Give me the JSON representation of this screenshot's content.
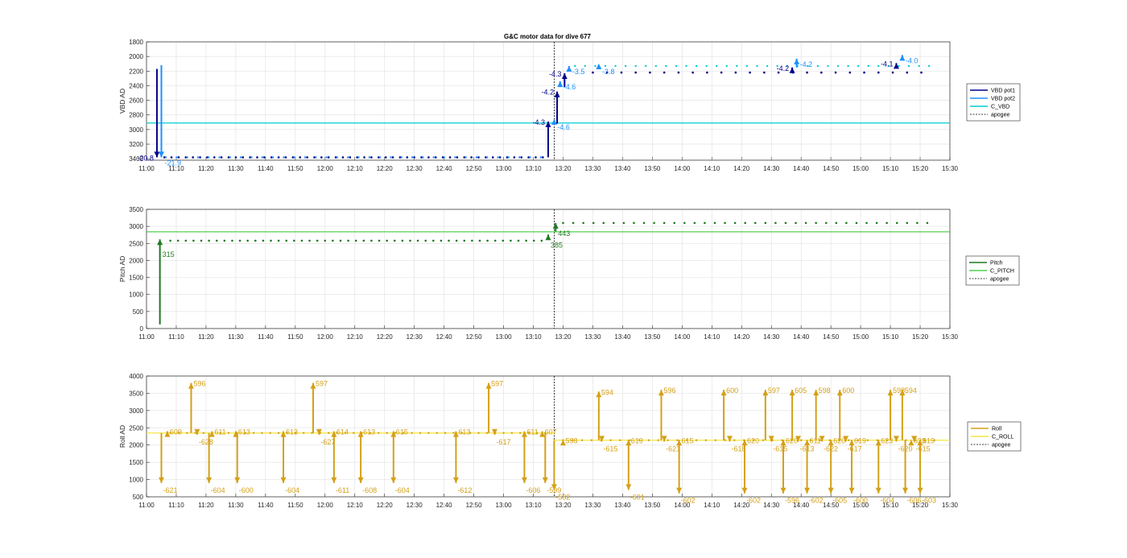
{
  "figure_title": "G&C motor data for dive 677",
  "chart_data": [
    {
      "id": "vbd",
      "type": "scatter",
      "ylabel": "VBD AD",
      "x_ticks": [
        "11:00",
        "11:10",
        "11:20",
        "11:30",
        "11:40",
        "11:50",
        "12:00",
        "12:10",
        "12:20",
        "12:30",
        "12:40",
        "12:50",
        "13:00",
        "13:10",
        "13:20",
        "13:30",
        "13:40",
        "13:50",
        "14:00",
        "14:10",
        "14:20",
        "14:30",
        "14:40",
        "14:50",
        "15:00",
        "15:10",
        "15:20",
        "15:30"
      ],
      "xlim": [
        0,
        270
      ],
      "ylim": [
        3420,
        1800
      ],
      "y_reversed": true,
      "y_ticks": [
        "1800",
        "2000",
        "2200",
        "2400",
        "2600",
        "2800",
        "3000",
        "3200",
        "3400"
      ],
      "grid": true,
      "apogee_x": 137,
      "legend": [
        "VBD pot1",
        "VBD pot2",
        "C_VBD",
        "apogee"
      ],
      "colors": {
        "pot1": "#00008b",
        "pot2": "#1e90ff",
        "cvbd": "#00ced1",
        "apogee": "#000000"
      },
      "c_vbd": 2910,
      "pot1_moves": [
        [
          3.5,
          2170,
          3380,
          "-20.8"
        ],
        [
          135,
          3380,
          2890,
          "-4.3"
        ],
        [
          138,
          2920,
          2480,
          "-4.2"
        ],
        [
          140.5,
          2420,
          2230,
          "-4.3"
        ],
        [
          217,
          2220,
          2150,
          "-4.2"
        ],
        [
          252,
          2150,
          2090,
          "-4.1"
        ]
      ],
      "pot2_moves": [
        [
          5,
          2120,
          3380,
          "-21.9"
        ],
        [
          137,
          2890,
          2890,
          "-4.6"
        ],
        [
          139,
          2420,
          2340,
          "-4.6"
        ],
        [
          142,
          2200,
          2130,
          "-3.5"
        ],
        [
          152,
          2130,
          2130,
          "-3.8"
        ],
        [
          218.5,
          2150,
          2030,
          "-4.2"
        ],
        [
          254,
          2020,
          1980,
          "-4.0"
        ]
      ],
      "pot1_points": {
        "start": 6,
        "end": 134,
        "step": 2.4,
        "y": 3380,
        "late_start": 150,
        "late_end": 262,
        "late_step": 4.8,
        "late_y": 2220
      },
      "pot2_points": {
        "start": 6.5,
        "end": 134,
        "step": 3.6,
        "y": 3380,
        "late_start": 144,
        "late_end": 265,
        "late_step": 3.4,
        "late_y": 2130
      }
    },
    {
      "id": "pitch",
      "type": "scatter",
      "ylabel": "Pitch AD",
      "x_ticks": [
        "11:00",
        "11:10",
        "11:20",
        "11:30",
        "11:40",
        "11:50",
        "12:00",
        "12:10",
        "12:20",
        "12:30",
        "12:40",
        "12:50",
        "13:00",
        "13:10",
        "13:20",
        "13:30",
        "13:40",
        "13:50",
        "14:00",
        "14:10",
        "14:20",
        "14:30",
        "14:40",
        "14:50",
        "15:00",
        "15:10",
        "15:20",
        "15:30"
      ],
      "xlim": [
        0,
        270
      ],
      "ylim": [
        0,
        3500
      ],
      "y_ticks": [
        "0",
        "500",
        "1000",
        "1500",
        "2000",
        "2500",
        "3000",
        "3500"
      ],
      "grid": true,
      "apogee_x": 137,
      "legend": [
        "Pitch",
        "C_PITCH",
        "apogee"
      ],
      "colors": {
        "pitch": "#1f7a1f",
        "cpitch": "#50d050",
        "apogee": "#000000"
      },
      "c_pitch": 2840,
      "moves": [
        [
          4.5,
          120,
          2620,
          "315"
        ],
        [
          135,
          2600,
          2760,
          "385"
        ],
        [
          137.5,
          2850,
          3100,
          "443"
        ]
      ],
      "points": {
        "start": 8,
        "end": 134,
        "step": 2.6,
        "y": 2580,
        "late_start": 140,
        "late_end": 265,
        "late_step": 3.4,
        "late_y": 3100
      }
    },
    {
      "id": "roll",
      "type": "scatter",
      "ylabel": "Roll AD",
      "x_ticks": [
        "11:00",
        "11:10",
        "11:20",
        "11:30",
        "11:40",
        "11:50",
        "12:00",
        "12:10",
        "12:20",
        "12:30",
        "12:40",
        "12:50",
        "13:00",
        "13:10",
        "13:20",
        "13:30",
        "13:40",
        "13:50",
        "14:00",
        "14:10",
        "14:20",
        "14:30",
        "14:40",
        "14:50",
        "15:00",
        "15:10",
        "15:20",
        "15:30"
      ],
      "xlim": [
        0,
        270
      ],
      "ylim": [
        500,
        4000
      ],
      "y_ticks": [
        "500",
        "1000",
        "1500",
        "2000",
        "2500",
        "3000",
        "3500",
        "4000"
      ],
      "grid": true,
      "apogee_x": 137,
      "legend": [
        "Roll",
        "C_ROLL",
        "apogee"
      ],
      "colors": {
        "roll": "#d4a017",
        "croll": "#f5e642",
        "apogee": "#000000"
      },
      "c_roll_early": 2350,
      "c_roll_late": 2140,
      "early_y": 2350,
      "late_y": 2140,
      "spikes": [
        [
          5,
          "-621",
          900
        ],
        [
          7,
          "609",
          2400
        ],
        [
          15,
          "596",
          3800
        ],
        [
          17,
          "-628",
          2300
        ],
        [
          22,
          "611",
          2400
        ],
        [
          21,
          "-604",
          900
        ],
        [
          30,
          "613",
          2400
        ],
        [
          30.5,
          "-600",
          900
        ],
        [
          46,
          "613",
          2400
        ],
        [
          46,
          "-604",
          900
        ],
        [
          56,
          "597",
          3800
        ],
        [
          58,
          "-627",
          2300
        ],
        [
          63,
          "614",
          2400
        ],
        [
          63,
          "-611",
          900
        ],
        [
          72,
          "613",
          2400
        ],
        [
          72,
          "-608",
          900
        ],
        [
          83,
          "615",
          2400
        ],
        [
          83,
          "-604",
          900
        ],
        [
          104,
          "613",
          2400
        ],
        [
          104,
          "-612",
          900
        ],
        [
          115,
          "597",
          3800
        ],
        [
          117,
          "-617",
          2300
        ],
        [
          127,
          "611",
          2400
        ],
        [
          127,
          "-606",
          900
        ],
        [
          133,
          "607",
          2400
        ],
        [
          134,
          "-599",
          900
        ],
        [
          137,
          "-582",
          700
        ],
        [
          140,
          "598",
          2150
        ],
        [
          152,
          "594",
          3550
        ],
        [
          153,
          "-615",
          2100
        ],
        [
          162,
          "619",
          2150
        ],
        [
          162,
          "-601",
          700
        ],
        [
          173,
          "596",
          3600
        ],
        [
          174,
          "-621",
          2100
        ],
        [
          179,
          "615",
          2150
        ],
        [
          179,
          "-602",
          600
        ],
        [
          194,
          "600",
          3600
        ],
        [
          196,
          "-618",
          2100
        ],
        [
          201,
          "620",
          2150
        ],
        [
          201,
          "-602",
          600
        ],
        [
          208,
          "597",
          3600
        ],
        [
          210,
          "-615",
          2100
        ],
        [
          214,
          "620",
          2150
        ],
        [
          214,
          "-596",
          600
        ],
        [
          217,
          "605",
          3600
        ],
        [
          219,
          "-613",
          2100
        ],
        [
          222,
          "611",
          2150
        ],
        [
          222,
          "-602",
          600
        ],
        [
          225,
          "598",
          3600
        ],
        [
          227,
          "-622",
          2100
        ],
        [
          230,
          "620",
          2150
        ],
        [
          230,
          "-605",
          600
        ],
        [
          233,
          "600",
          3600
        ],
        [
          235,
          "-617",
          2100
        ],
        [
          237,
          "619",
          2150
        ],
        [
          237,
          "-600",
          600
        ],
        [
          246,
          "623",
          2150
        ],
        [
          246,
          "-604",
          600
        ],
        [
          250,
          "598",
          3600
        ],
        [
          252,
          "-620",
          2100
        ],
        [
          254,
          "594",
          3600
        ],
        [
          255,
          "-606",
          600
        ],
        [
          257,
          "623",
          2150
        ],
        [
          258,
          "-615",
          2100
        ],
        [
          260,
          "619",
          2150
        ],
        [
          260,
          "-603",
          600
        ]
      ]
    }
  ]
}
